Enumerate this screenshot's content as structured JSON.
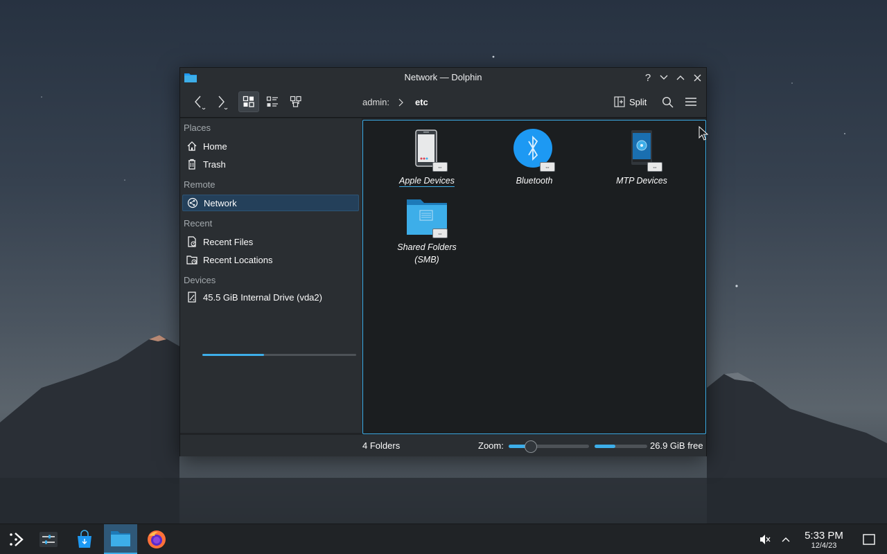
{
  "window": {
    "title": "Network — Dolphin",
    "buttons": {
      "help": "?",
      "minimize": "⌄",
      "maximize": "⌃",
      "close": "✕"
    }
  },
  "toolbar": {
    "breadcrumb": [
      "admin:",
      "etc"
    ],
    "split_label": "Split"
  },
  "sidebar": {
    "sections": {
      "places": "Places",
      "remote": "Remote",
      "recent": "Recent",
      "devices": "Devices"
    },
    "items": {
      "home": "Home",
      "trash": "Trash",
      "network": "Network",
      "recent_files": "Recent Files",
      "recent_locations": "Recent Locations",
      "drive": "45.5 GiB Internal Drive (vda2)"
    },
    "drive_usage_fraction": 0.4
  },
  "view": {
    "items": [
      {
        "label": "Apple Devices",
        "icon": "phone-icon"
      },
      {
        "label": "Bluetooth",
        "icon": "bluetooth-icon"
      },
      {
        "label": "MTP Devices",
        "icon": "mtp-device-icon"
      },
      {
        "label": "Shared Folders\n(SMB)",
        "icon": "network-folder-icon"
      }
    ]
  },
  "status": {
    "count": "4 Folders",
    "zoom_label": "Zoom:",
    "zoom_fraction": 0.28,
    "free_space": "26.9 GiB free",
    "free_fraction": 0.4
  },
  "taskbar": {
    "time": "5:33 PM",
    "date": "12/4/23"
  },
  "colors": {
    "accent": "#3daee9",
    "selection": "#24405a",
    "window_bg": "#202326",
    "view_bg": "#1b1e20"
  }
}
